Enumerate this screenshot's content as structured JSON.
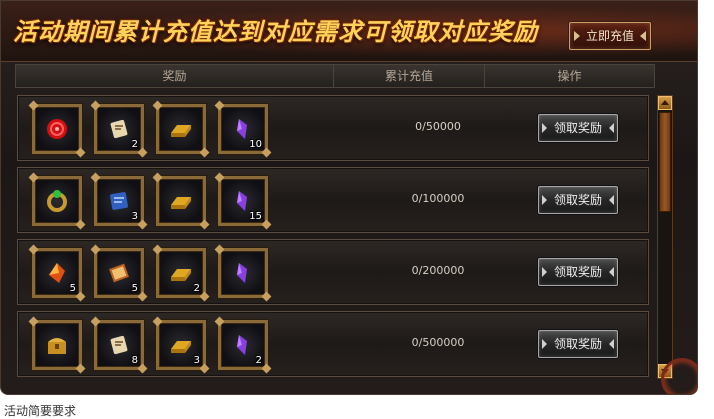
{
  "header": {
    "title": "活动期间累计充值达到对应需求可领取对应奖励",
    "recharge_button": "立即充值"
  },
  "table": {
    "col_rewards": "奖励",
    "col_recharge": "累计充值",
    "col_action": "操作"
  },
  "rows": [
    {
      "progress": "0/50000",
      "claim_label": "领取奖励",
      "items": [
        {
          "icon": "red-orb-icon",
          "qty": ""
        },
        {
          "icon": "scroll-icon",
          "qty": "2"
        },
        {
          "icon": "gold-ingot-icon",
          "qty": ""
        },
        {
          "icon": "purple-crystal-icon",
          "qty": "10"
        }
      ]
    },
    {
      "progress": "0/100000",
      "claim_label": "领取奖励",
      "items": [
        {
          "icon": "green-ring-icon",
          "qty": ""
        },
        {
          "icon": "blue-scroll-icon",
          "qty": "3"
        },
        {
          "icon": "gold-ingot-icon",
          "qty": ""
        },
        {
          "icon": "purple-crystal-icon",
          "qty": "15"
        }
      ]
    },
    {
      "progress": "0/200000",
      "claim_label": "领取奖励",
      "items": [
        {
          "icon": "fire-crystal-icon",
          "qty": "5"
        },
        {
          "icon": "book-icon",
          "qty": "5"
        },
        {
          "icon": "gold-ingot-icon",
          "qty": "2"
        },
        {
          "icon": "purple-crystal-icon",
          "qty": ""
        }
      ]
    },
    {
      "progress": "0/500000",
      "claim_label": "领取奖励",
      "items": [
        {
          "icon": "treasure-chest-icon",
          "qty": ""
        },
        {
          "icon": "scroll-icon",
          "qty": "8"
        },
        {
          "icon": "gold-ingot-icon",
          "qty": "3"
        },
        {
          "icon": "purple-crystal-icon",
          "qty": "2"
        }
      ]
    }
  ],
  "footer_text": "活动简要要求"
}
